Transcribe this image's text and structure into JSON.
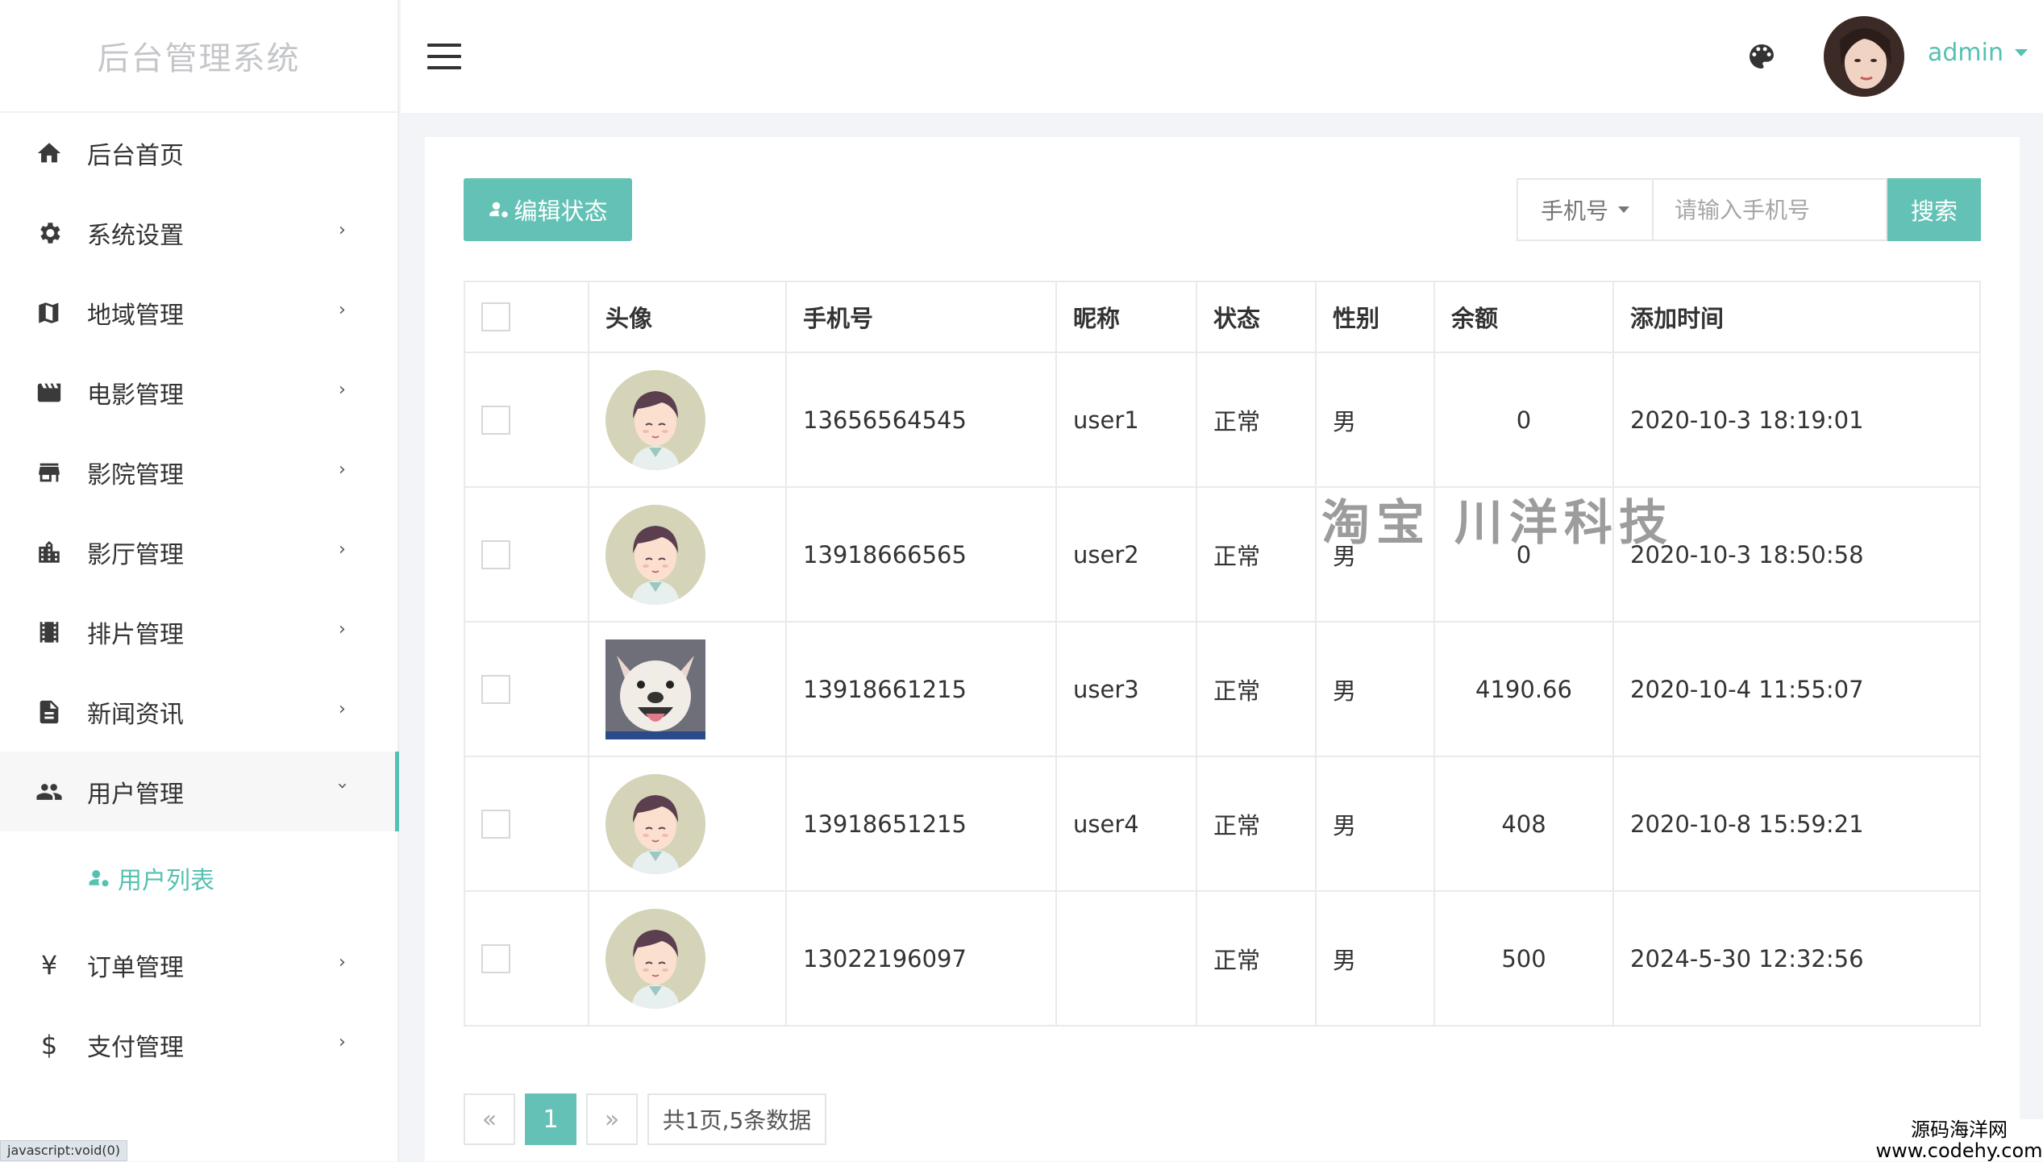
{
  "app": {
    "title": "后台管理系统"
  },
  "sidebar": {
    "items": [
      {
        "label": "后台首页",
        "icon": "home-icon"
      },
      {
        "label": "系统设置",
        "icon": "gear-icon"
      },
      {
        "label": "地域管理",
        "icon": "map-icon"
      },
      {
        "label": "电影管理",
        "icon": "clapperboard-icon"
      },
      {
        "label": "影院管理",
        "icon": "store-icon"
      },
      {
        "label": "影厅管理",
        "icon": "building-icon"
      },
      {
        "label": "排片管理",
        "icon": "film-strip-icon"
      },
      {
        "label": "新闻资讯",
        "icon": "document-icon"
      },
      {
        "label": "用户管理",
        "icon": "users-icon"
      },
      {
        "label": "订单管理",
        "icon": "yen-icon"
      },
      {
        "label": "支付管理",
        "icon": "dollar-icon"
      }
    ],
    "sub_item": "用户列表",
    "chevron": "›",
    "status_tip": "javascript:void(0)"
  },
  "header": {
    "username": "admin"
  },
  "toolbar": {
    "edit_label": "编辑状态",
    "search_field": "手机号",
    "search_placeholder": "请输入手机号",
    "search_label": "搜索"
  },
  "table": {
    "headers": [
      "头像",
      "手机号",
      "昵称",
      "状态",
      "性别",
      "余额",
      "添加时间"
    ],
    "rows": [
      {
        "phone": "13656564545",
        "nickname": "user1",
        "status": "正常",
        "gender": "男",
        "balance": "0",
        "added": "2020-10-3 18:19:01",
        "avatar": "cartoon"
      },
      {
        "phone": "13918666565",
        "nickname": "user2",
        "status": "正常",
        "gender": "男",
        "balance": "0",
        "added": "2020-10-3 18:50:58",
        "avatar": "cartoon"
      },
      {
        "phone": "13918661215",
        "nickname": "user3",
        "status": "正常",
        "gender": "男",
        "balance": "4190.66",
        "added": "2020-10-4 11:55:07",
        "avatar": "dog"
      },
      {
        "phone": "13918651215",
        "nickname": "user4",
        "status": "正常",
        "gender": "男",
        "balance": "408",
        "added": "2020-10-8 15:59:21",
        "avatar": "cartoon"
      },
      {
        "phone": "13022196097",
        "nickname": "",
        "status": "正常",
        "gender": "男",
        "balance": "500",
        "added": "2024-5-30 12:32:56",
        "avatar": "cartoon"
      }
    ]
  },
  "pagination": {
    "prev": "«",
    "current": "1",
    "next": "»",
    "info": "共1页,5条数据"
  },
  "watermark": "淘宝 川洋科技",
  "brand": {
    "line1": "源码海洋网",
    "line2": "www.codehy.com"
  },
  "colors": {
    "accent": "#63c2b5",
    "green_text": "#55b57b"
  }
}
